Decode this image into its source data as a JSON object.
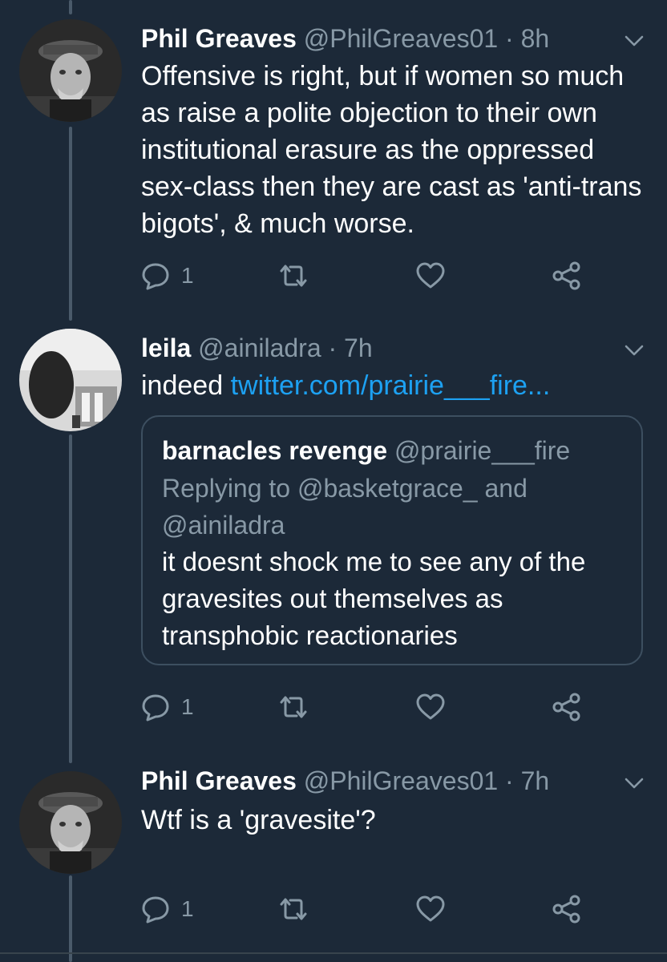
{
  "colors": {
    "background": "#1c2938",
    "text": "#ffffff",
    "secondary": "#8899a6",
    "link": "#1da1f2"
  },
  "tweets": [
    {
      "name": "Phil Greaves",
      "handle": "@PhilGreaves01",
      "separator": "·",
      "time": "8h",
      "text": "Offensive is right, but if women so much as raise a polite objection to their own institutional erasure as the oppressed sex-class then they are cast as 'anti-trans bigots', & much worse.",
      "reply_count": "1",
      "icons": [
        "reply-icon",
        "retweet-icon",
        "like-icon",
        "share-icon"
      ]
    },
    {
      "name": "leila",
      "handle": "@ainiladra",
      "separator": "·",
      "time": "7h",
      "text": "indeed",
      "link": "twitter.com/prairie___fire...",
      "reply_count": "1",
      "quote": {
        "name": "barnacles revenge",
        "handle": "@prairie___fire",
        "replying": "Replying to @basketgrace_ and @ainiladra",
        "text": "it doesnt shock me to see any of the gravesites out themselves as transphobic reactionaries"
      },
      "icons": [
        "reply-icon",
        "retweet-icon",
        "like-icon",
        "share-icon"
      ]
    },
    {
      "name": "Phil Greaves",
      "handle": "@PhilGreaves01",
      "separator": "·",
      "time": "7h",
      "text": "Wtf is a 'gravesite'?",
      "reply_count": "1",
      "icons": [
        "reply-icon",
        "retweet-icon",
        "like-icon",
        "share-icon"
      ]
    }
  ]
}
